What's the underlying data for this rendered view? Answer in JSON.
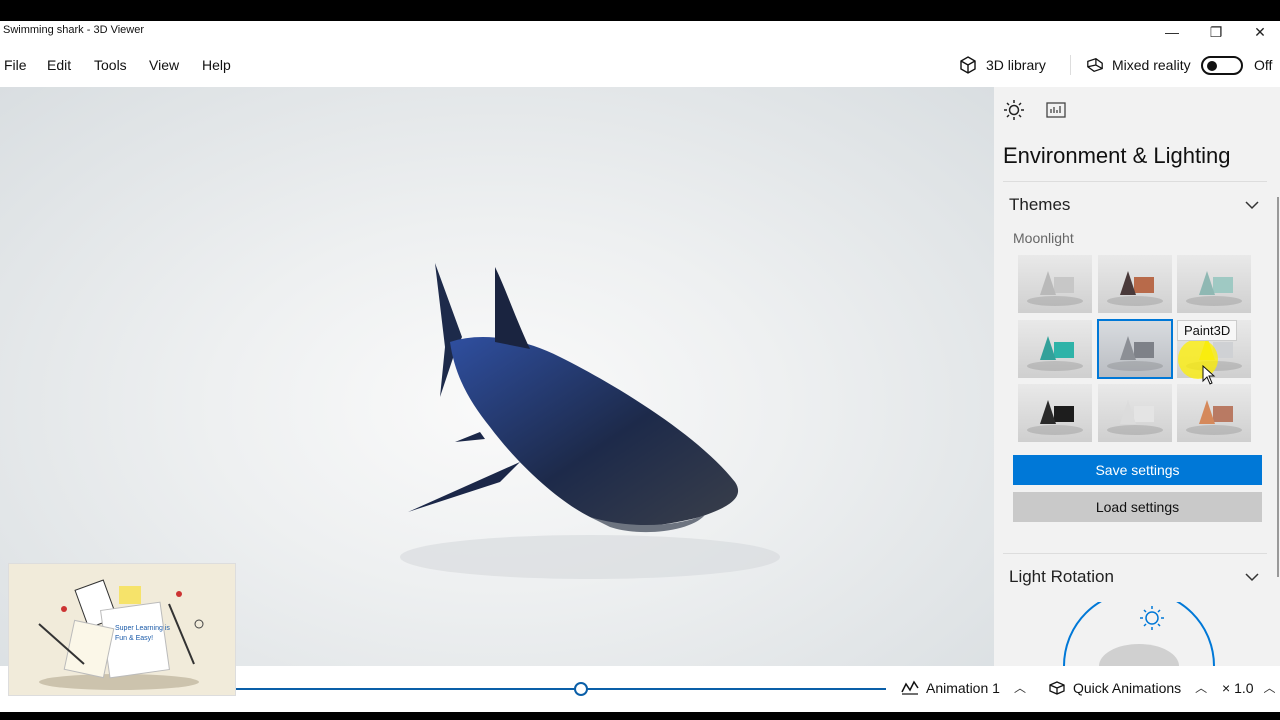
{
  "window": {
    "title": "Swimming shark - 3D Viewer",
    "minimize_glyph": "—",
    "maximize_glyph": "❐",
    "close_glyph": "✕"
  },
  "menu": {
    "items": [
      "File",
      "Edit",
      "Tools",
      "View",
      "Help"
    ],
    "library_label": "3D library",
    "mixed_reality_label": "Mixed reality",
    "mixed_reality_state": "Off"
  },
  "panel": {
    "title": "Environment & Lighting",
    "themes": {
      "header": "Themes",
      "selected_name": "Moonlight",
      "tooltip": "Paint3D",
      "items": [
        {
          "shape": "#b9b9b9",
          "box": "#c7c7c7"
        },
        {
          "shape": "#4a3a3a",
          "box": "#b86a4a"
        },
        {
          "shape": "#8fb8b3",
          "box": "#9fc9c3"
        },
        {
          "shape": "#33a19a",
          "box": "#2fb3a8"
        },
        {
          "shape": "#8c8f95",
          "box": "#7e8188"
        },
        {
          "shape": "#e6e43a",
          "box": "#cfd1d4"
        },
        {
          "shape": "#2a2a2a",
          "box": "#1d1d1d"
        },
        {
          "shape": "#dcdcdc",
          "box": "#e4e4e4"
        },
        {
          "shape": "#d5895b",
          "box": "#b97a63"
        }
      ]
    },
    "save_label": "Save settings",
    "load_label": "Load settings",
    "light_rotation_header": "Light Rotation"
  },
  "bottom": {
    "animation_label": "Animation 1",
    "quick_label": "Quick Animations",
    "speed_label": "× 1.0",
    "playback_fraction": 0.53
  },
  "thumbnail": {
    "caption": "Super Learning is Fun & Easy!"
  },
  "colors": {
    "accent": "#0078d7",
    "shark_body": "#1d2a4a",
    "shark_highlight": "#2f4fa0"
  }
}
